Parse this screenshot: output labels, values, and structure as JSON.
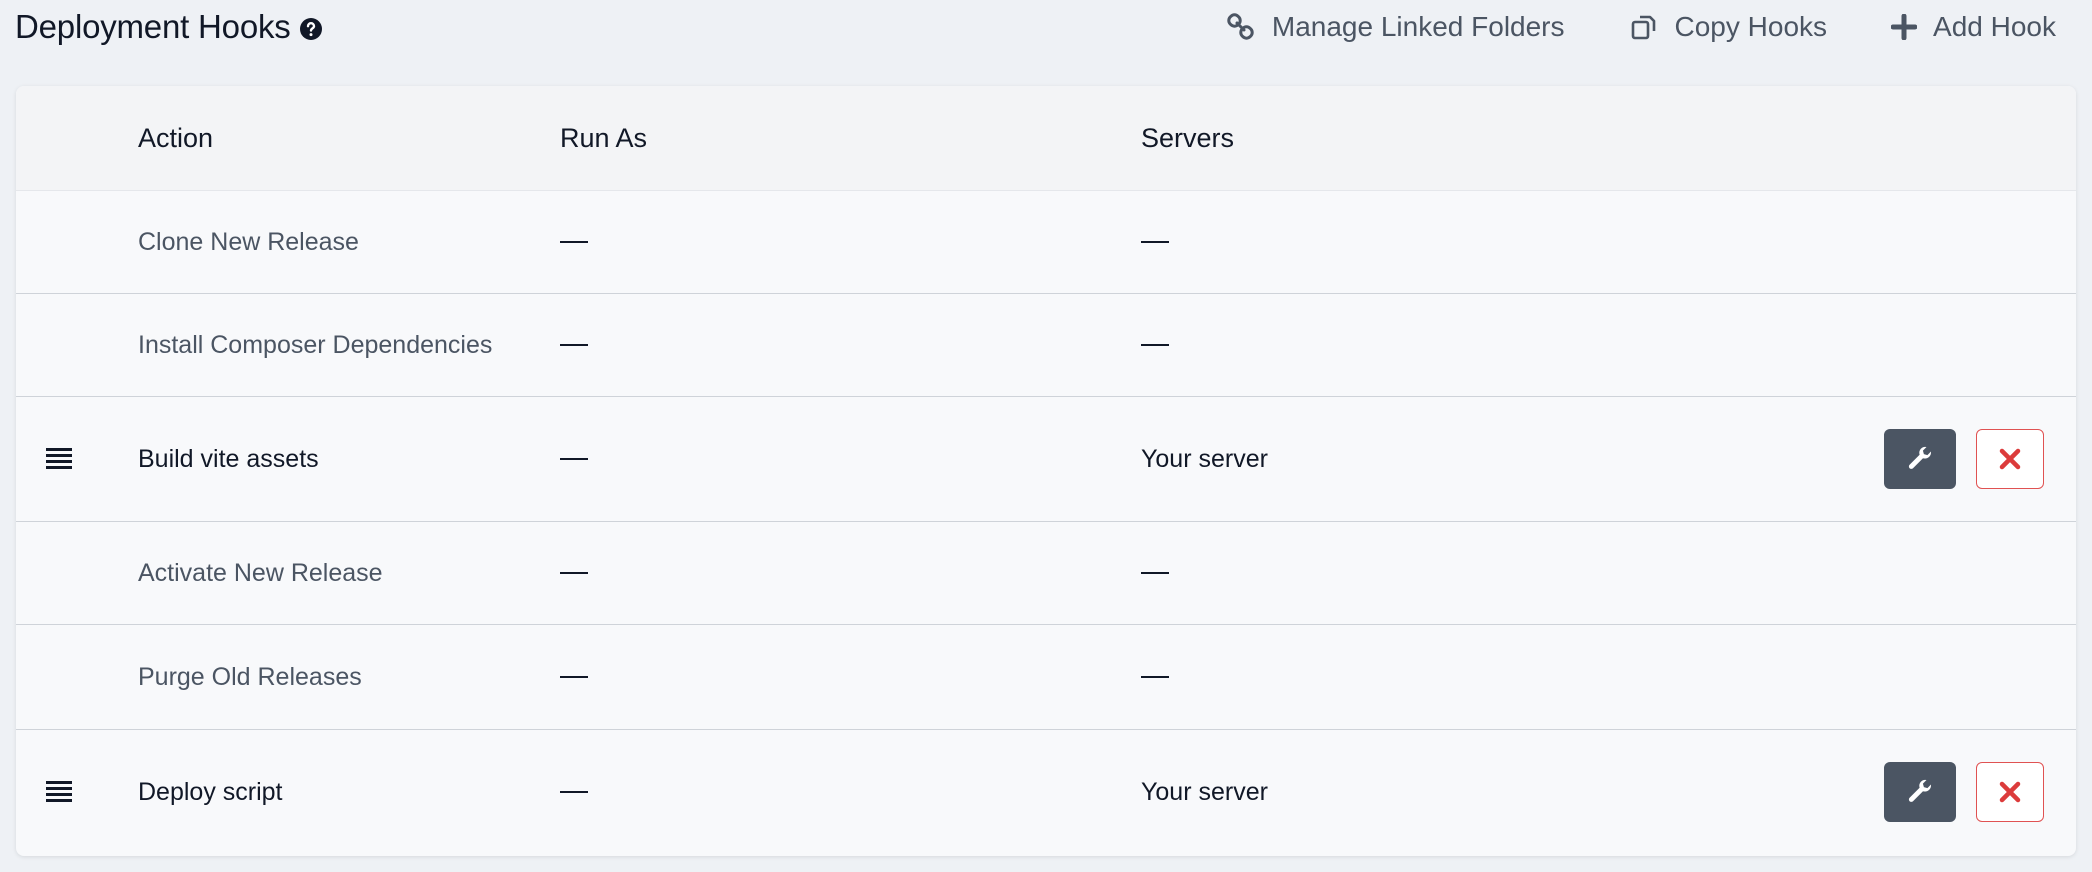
{
  "header": {
    "title": "Deployment Hooks",
    "help_icon": "question-circle-icon",
    "actions": [
      {
        "label": "Manage Linked Folders",
        "icon": "link-icon"
      },
      {
        "label": "Copy Hooks",
        "icon": "copy-icon"
      },
      {
        "label": "Add Hook",
        "icon": "plus-icon"
      }
    ]
  },
  "table": {
    "columns": {
      "action": "Action",
      "run_as": "Run As",
      "servers": "Servers"
    },
    "rows": [
      {
        "action": "Clone New Release",
        "run_as": "—",
        "servers": "—",
        "custom": false
      },
      {
        "action": "Install Composer Dependencies",
        "run_as": "—",
        "servers": "—",
        "custom": false
      },
      {
        "action": "Build vite assets",
        "run_as": "—",
        "servers": "Your server",
        "custom": true
      },
      {
        "action": "Activate New Release",
        "run_as": "—",
        "servers": "—",
        "custom": false
      },
      {
        "action": "Purge Old Releases",
        "run_as": "—",
        "servers": "—",
        "custom": false
      },
      {
        "action": "Deploy script",
        "run_as": "—",
        "servers": "Your server",
        "custom": true
      }
    ]
  },
  "colors": {
    "edit_button": "#4b5563",
    "delete_icon": "#dc3b3b",
    "background": "#eef1f5"
  }
}
